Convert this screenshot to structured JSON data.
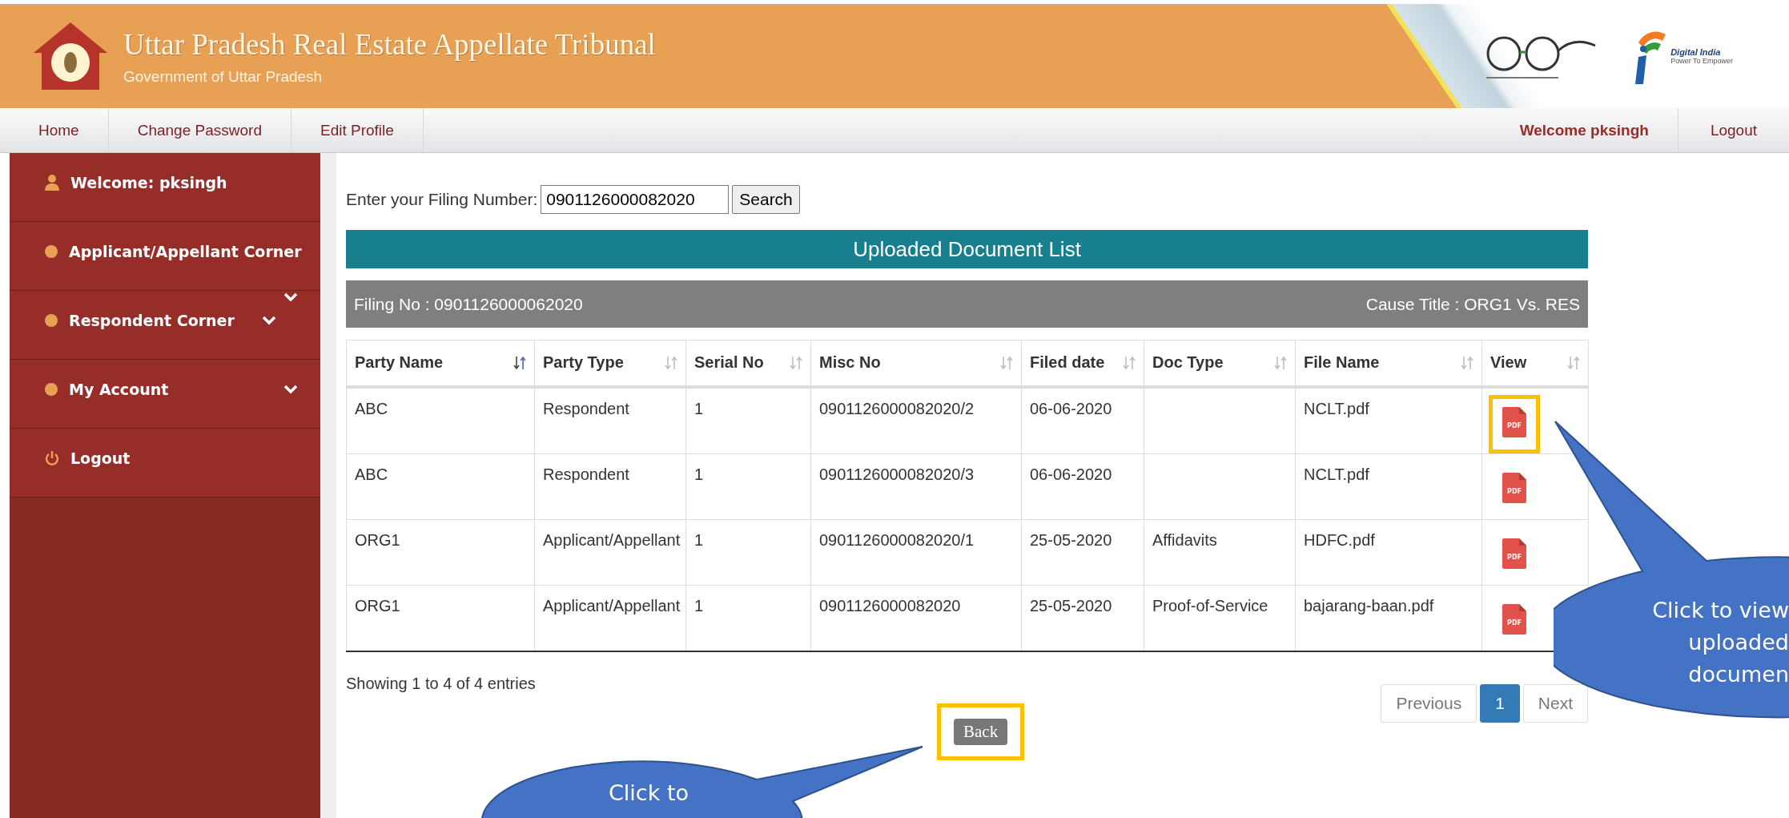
{
  "header": {
    "title": "Uttar Pradesh Real Estate Appellate Tribunal",
    "subtitle": "Government of Uttar Pradesh",
    "partner_logo": {
      "name": "Digital India",
      "tagline": "Power To Empower"
    }
  },
  "nav": {
    "left": [
      "Home",
      "Change Password",
      "Edit Profile"
    ],
    "welcome": "Welcome pksingh",
    "logout": "Logout"
  },
  "sidebar": {
    "items": [
      {
        "kind": "user",
        "label": "Welcome: pksingh",
        "expandable": false,
        "extra_chevron": false
      },
      {
        "kind": "dot",
        "label": "Applicant/Appellant Corner",
        "expandable": false,
        "extra_chevron": false
      },
      {
        "kind": "dot",
        "label": "Respondent Corner",
        "expandable": true,
        "extra_chevron": true
      },
      {
        "kind": "dot",
        "label": "My Account",
        "expandable": true,
        "extra_chevron": false
      },
      {
        "kind": "power",
        "label": "Logout",
        "expandable": false,
        "extra_chevron": false
      }
    ]
  },
  "search": {
    "label": "Enter your Filing Number:",
    "value": "0901126000082020",
    "button": "Search"
  },
  "list_title": "Uploaded Document List",
  "info_bar": {
    "filing_no": "Filing No : 0901126000062020",
    "cause_title": "Cause Title : ORG1 Vs. RES"
  },
  "table": {
    "columns": [
      {
        "label": "Party Name",
        "sorted": true
      },
      {
        "label": "Party Type",
        "sorted": false
      },
      {
        "label": "Serial No",
        "sorted": false
      },
      {
        "label": "Misc No",
        "sorted": false
      },
      {
        "label": "Filed date",
        "sorted": false
      },
      {
        "label": "Doc Type",
        "sorted": false
      },
      {
        "label": "File Name",
        "sorted": false
      },
      {
        "label": "View",
        "sorted": false
      }
    ],
    "rows": [
      {
        "cells": [
          "ABC",
          "Respondent",
          "1",
          "0901126000082020/2",
          "06-06-2020",
          "",
          "NCLT.pdf"
        ],
        "view": "PDF",
        "highlighted": true
      },
      {
        "cells": [
          "ABC",
          "Respondent",
          "1",
          "0901126000082020/3",
          "06-06-2020",
          "",
          "NCLT.pdf"
        ],
        "view": "PDF",
        "highlighted": false
      },
      {
        "cells": [
          "ORG1",
          "Applicant/Appellant",
          "1",
          "0901126000082020/1",
          "25-05-2020",
          "Affidavits",
          "HDFC.pdf"
        ],
        "view": "PDF",
        "highlighted": false
      },
      {
        "cells": [
          "ORG1",
          "Applicant/Appellant",
          "1",
          "0901126000082020",
          "25-05-2020",
          "Proof-of-Service",
          "bajarang-baan.pdf"
        ],
        "view": "PDF",
        "highlighted": false
      }
    ]
  },
  "summary": "Showing 1 to 4 of 4 entries",
  "pagination": [
    {
      "label": "Previous",
      "selected": false
    },
    {
      "label": "1",
      "selected": true
    },
    {
      "label": "Next",
      "selected": false
    }
  ],
  "back": {
    "label": "Back",
    "highlighted": true
  },
  "callouts": [
    {
      "kind": "right",
      "lines": [
        "Click to view",
        "uploaded",
        "documen"
      ]
    },
    {
      "kind": "bottom",
      "lines": [
        "Click to"
      ]
    }
  ]
}
